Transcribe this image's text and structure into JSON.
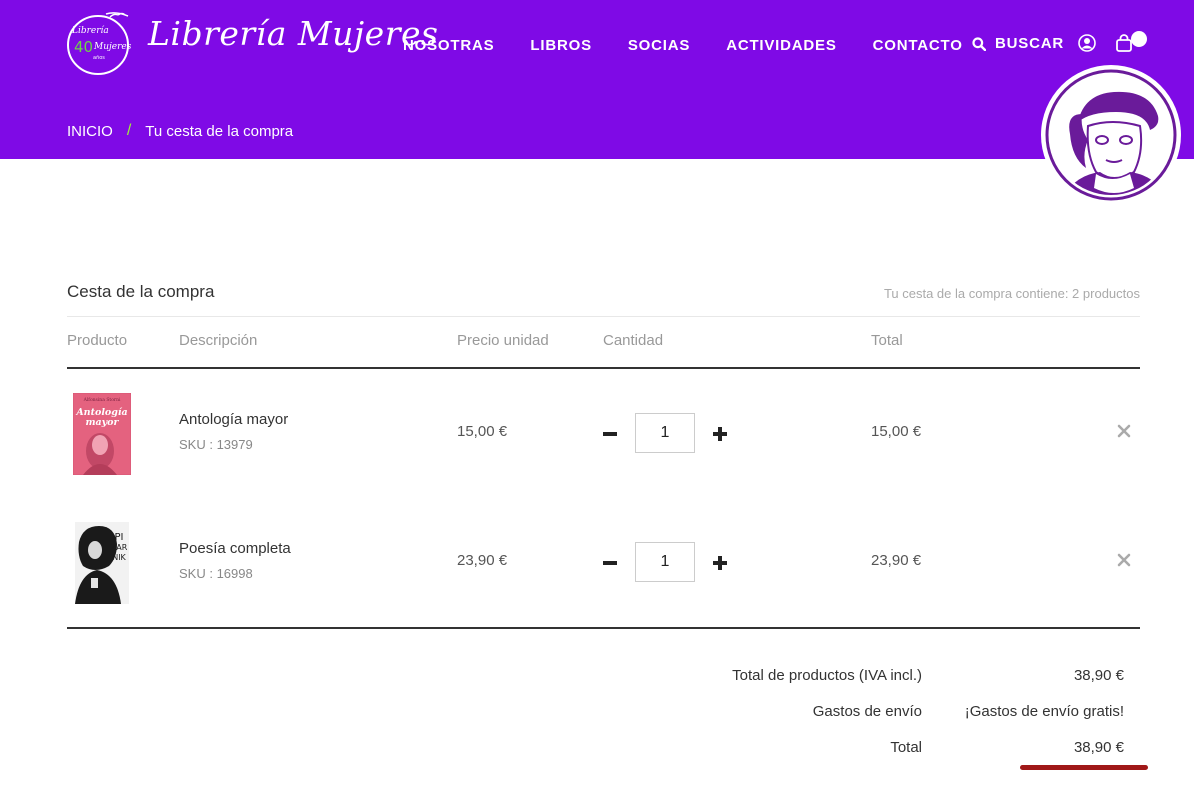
{
  "header": {
    "logo_text": "Librería Mujeres",
    "logo_badge_top": "Librería",
    "logo_badge_num": "40",
    "logo_badge_bottom": "Mujeres",
    "logo_badge_year": "años",
    "nav": [
      "NOSOTRAS",
      "LIBROS",
      "SOCIAS",
      "ACTIVIDADES",
      "CONTACTO"
    ],
    "search_label": "BUSCAR",
    "brand_color": "#7f0ae6",
    "accent_color": "#9ff03c"
  },
  "breadcrumb": {
    "home": "INICIO",
    "separator": "/",
    "current": "Tu cesta de la compra"
  },
  "cart": {
    "title": "Cesta de la compra",
    "count_text": "Tu cesta de la compra contiene: 2 productos",
    "columns": {
      "product": "Producto",
      "description": "Descripción",
      "unit_price": "Precio unidad",
      "quantity": "Cantidad",
      "total": "Total"
    },
    "items": [
      {
        "name": "Antología mayor",
        "sku": "SKU : 13979",
        "price": "15,00 €",
        "qty": "1",
        "total": "15,00 €",
        "cover_author": "Alfonsina Storni",
        "cover_title_1": "Antología",
        "cover_title_2": "mayor",
        "cover_color": "#e4627f"
      },
      {
        "name": "Poesía completa",
        "sku": "SKU : 16998",
        "price": "23,90 €",
        "qty": "1",
        "total": "23,90 €",
        "cover_line_1": "PI",
        "cover_line_2": "ZAR",
        "cover_line_3": "NIK",
        "cover_color": "#1a1a1a"
      }
    ]
  },
  "summary": {
    "products_label": "Total de productos (IVA incl.)",
    "products_value": "38,90 €",
    "shipping_label": "Gastos de envío",
    "shipping_value": "¡Gastos de envío gratis!",
    "total_label": "Total",
    "total_value": "38,90 €",
    "underline_color": "#a01818"
  }
}
